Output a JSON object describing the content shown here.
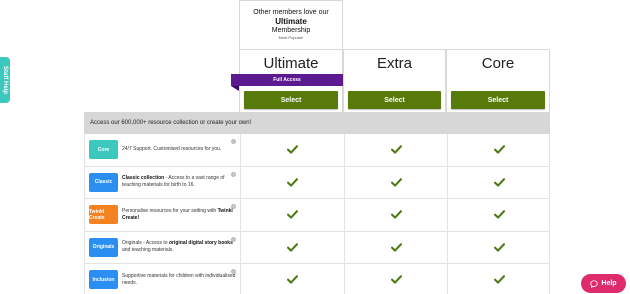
{
  "staff_help": {
    "label": "Staff Help"
  },
  "promo": {
    "line1": "Other members love our",
    "line2": "Ultimate",
    "line3": "Membership",
    "line4": "Most Popular!"
  },
  "plans": [
    {
      "name": "Ultimate",
      "select_label": "Select"
    },
    {
      "name": "Extra",
      "select_label": "Select"
    },
    {
      "name": "Core",
      "select_label": "Select"
    }
  ],
  "ribbon": {
    "label": "Full Access",
    "color": "#5b1a8f"
  },
  "section": {
    "title": "Access our 600,000+ resource collection or create your own!"
  },
  "colors": {
    "select_button": "#577a0b",
    "check": "#4e7a12",
    "help_button": "#dd2b6c",
    "staff_tab": "#3cc7bf"
  },
  "features": [
    {
      "badge": "Core",
      "badge_color": "#3cc7bf",
      "lead": "",
      "text": "24/7 Support. Customised resources for you.",
      "bold": "",
      "tail": "",
      "checks": [
        "check-icon",
        "check-icon",
        "check-icon"
      ]
    },
    {
      "badge": "Classic",
      "badge_color": "#2a8ff0",
      "lead": "Classic collection",
      "text": " - Access to a vast range of teaching materials for birth to 16.",
      "bold": "",
      "tail": "",
      "checks": [
        "check-icon",
        "check-icon",
        "check-icon"
      ]
    },
    {
      "badge": "Twinkl Create",
      "badge_color": "#f58220",
      "lead": "",
      "text": "Personalise resources for your setting with ",
      "bold": "Twinkl Create!",
      "tail": "",
      "checks": [
        "check-icon",
        "check-icon",
        "check-icon"
      ]
    },
    {
      "badge": "Originals",
      "badge_color": "#2a8ff0",
      "lead": "",
      "text": "Originals - Access to ",
      "bold": "original digital story books",
      "tail": " and teaching materials.",
      "checks": [
        "check-icon",
        "check-icon",
        "check-icon"
      ]
    },
    {
      "badge": "Inclusion",
      "badge_color": "#2a8ff0",
      "lead": "",
      "text": "Supportive materials for children with individualised needs.",
      "bold": "",
      "tail": "",
      "checks": [
        "check-icon",
        "check-icon",
        "check-icon"
      ]
    }
  ],
  "help": {
    "label": "Help"
  }
}
